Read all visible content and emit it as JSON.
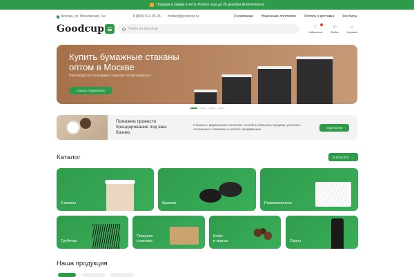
{
  "promo": {
    "text": "Подарки и скидки в честь Нового года до 26 декабря включительно",
    "icon": "gift-icon"
  },
  "topbar": {
    "address": "Москва, ул. Московская, 1кс",
    "phone": "8 (800) 512-06-06",
    "email": "market@goodcup.ru",
    "nav": [
      "О компании",
      "Нанесение логотипов",
      "Оплата и доставка",
      "Контакты"
    ]
  },
  "header": {
    "logo": "Goodcup",
    "search_placeholder": "Найти на Goodcup",
    "icons": [
      {
        "label": "Избранное",
        "icon": "heart-icon"
      },
      {
        "label": "Войти",
        "icon": "user-icon"
      },
      {
        "label": "Корзина",
        "icon": "cart-icon"
      }
    ]
  },
  "hero": {
    "title": "Купить бумажные стаканы оптом в Москве",
    "subtitle": "Производство и продажа стаканов оптом недорого",
    "button": "УЗНАТЬ ПОДРОБНЕЕ"
  },
  "branding": {
    "title": "Поможем провести брендирование под ваш бизнес",
    "text": "Стаканы с фирменным логотипом способны повысить продажи, улучшить отношение к компании и усилить продвижение",
    "button": "ПОДРОБНЕЕ"
  },
  "catalog": {
    "title": "Каталог",
    "button": "В КАТАЛОГ",
    "items": [
      "Стаканы",
      "Крышки",
      "Размешиватель",
      "Трубочки",
      "Пищевая\nупаковка",
      "Кофе\nв зернах",
      "Сироп"
    ]
  },
  "products": {
    "title": "Наша продукция"
  },
  "colors": {
    "brand": "#2e9b4b",
    "hero_bg": "#b88763"
  }
}
